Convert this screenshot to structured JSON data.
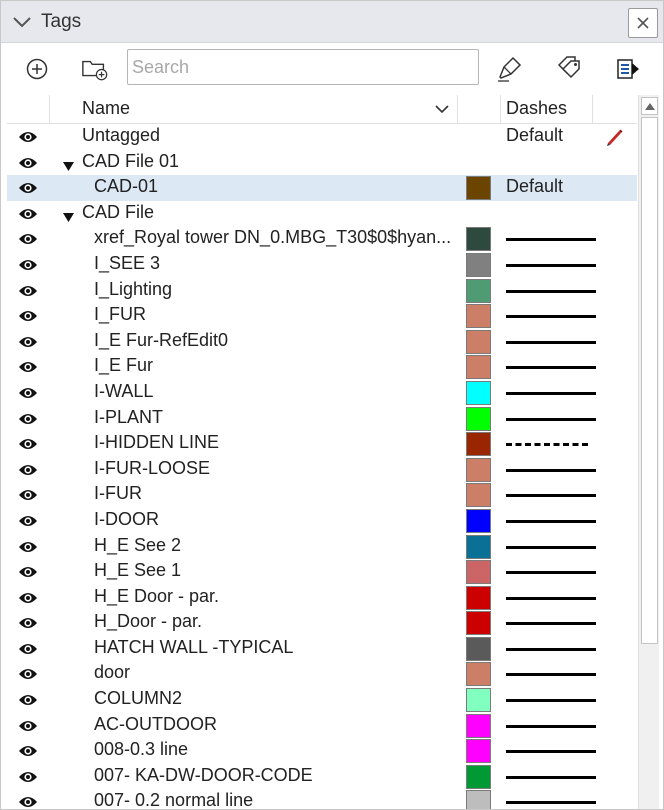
{
  "panel": {
    "title": "Tags"
  },
  "toolbar": {
    "search_placeholder": "Search",
    "search_value": "",
    "icons": [
      "add-tag-icon",
      "add-folder-icon",
      "color-by-tag-icon",
      "tag-tools-icon",
      "details-icon"
    ]
  },
  "columns": {
    "name": "Name",
    "dashes": "Dashes"
  },
  "rows": [
    {
      "name": "Untagged",
      "indent": 0,
      "dashes": "Default",
      "pencil": true
    },
    {
      "name": "CAD File 01",
      "indent": 0,
      "folder": true
    },
    {
      "name": "CAD-01",
      "indent": 1,
      "color": "#6b4500",
      "dashes": "Default",
      "selected": true
    },
    {
      "name": "CAD File",
      "indent": 0,
      "folder": true
    },
    {
      "name": "xref_Royal tower DN_0.MBG_T30$0$hyan...",
      "indent": 1,
      "color": "#2e4a3f",
      "line": "solid"
    },
    {
      "name": "I_SEE 3",
      "indent": 1,
      "color": "#808080",
      "line": "solid"
    },
    {
      "name": "I_Lighting",
      "indent": 1,
      "color": "#4f9b74",
      "line": "solid"
    },
    {
      "name": "I_FUR",
      "indent": 1,
      "color": "#cc7e66",
      "line": "solid"
    },
    {
      "name": "I_E Fur-RefEdit0",
      "indent": 1,
      "color": "#cc7e66",
      "line": "solid"
    },
    {
      "name": "I_E Fur",
      "indent": 1,
      "color": "#cc7e66",
      "line": "solid"
    },
    {
      "name": "I-WALL",
      "indent": 1,
      "color": "#00ffff",
      "line": "solid"
    },
    {
      "name": "I-PLANT",
      "indent": 1,
      "color": "#00ff00",
      "line": "solid"
    },
    {
      "name": "I-HIDDEN LINE",
      "indent": 1,
      "color": "#992600",
      "line": "dashed"
    },
    {
      "name": "I-FUR-LOOSE",
      "indent": 1,
      "color": "#cc7e66",
      "line": "solid"
    },
    {
      "name": "I-FUR",
      "indent": 1,
      "color": "#cc7e66",
      "line": "solid"
    },
    {
      "name": "I-DOOR",
      "indent": 1,
      "color": "#0000ff",
      "line": "solid"
    },
    {
      "name": "H_E See 2",
      "indent": 1,
      "color": "#0b7095",
      "line": "solid"
    },
    {
      "name": "H_E See 1",
      "indent": 1,
      "color": "#cc6666",
      "line": "solid"
    },
    {
      "name": "H_E Door - par.",
      "indent": 1,
      "color": "#cc0000",
      "line": "solid"
    },
    {
      "name": "H_Door - par.",
      "indent": 1,
      "color": "#cc0000",
      "line": "solid"
    },
    {
      "name": "HATCH WALL -TYPICAL",
      "indent": 1,
      "color": "#5a5a5a",
      "line": "solid"
    },
    {
      "name": "door",
      "indent": 1,
      "color": "#cc7e66",
      "line": "solid"
    },
    {
      "name": "COLUMN2",
      "indent": 1,
      "color": "#80ffbf",
      "line": "solid"
    },
    {
      "name": "AC-OUTDOOR",
      "indent": 1,
      "color": "#ff00ff",
      "line": "solid"
    },
    {
      "name": "008-0.3 line",
      "indent": 1,
      "color": "#ff00ff",
      "line": "solid"
    },
    {
      "name": "007- KA-DW-DOOR-CODE",
      "indent": 1,
      "color": "#009933",
      "line": "solid"
    },
    {
      "name": "007- 0.2 normal line",
      "indent": 1,
      "color": "#bdbdbd",
      "line": "solid"
    }
  ]
}
